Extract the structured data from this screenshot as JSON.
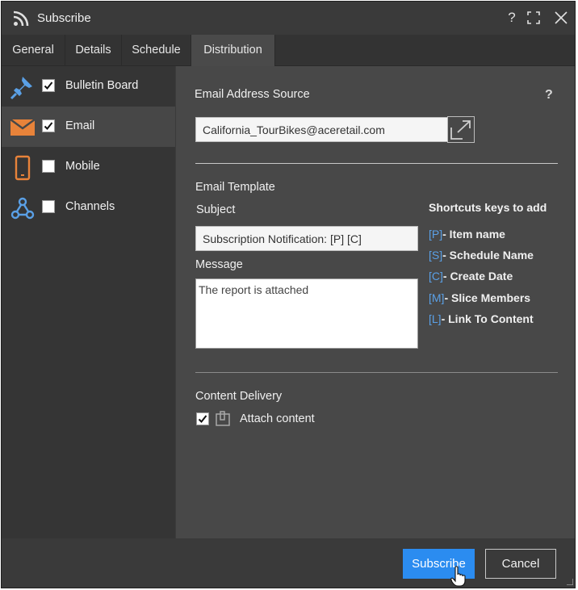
{
  "dialog": {
    "title": "Subscribe",
    "help_label": "?",
    "maximize_icon": "maximize-icon",
    "close_icon": "close-icon"
  },
  "tabs": [
    {
      "label": "General",
      "active": false
    },
    {
      "label": "Details",
      "active": false
    },
    {
      "label": "Schedule",
      "active": false
    },
    {
      "label": "Distribution",
      "active": true
    }
  ],
  "sidebar": {
    "items": [
      {
        "label": "Bulletin Board",
        "checked": true,
        "icon": "pushpin-icon",
        "selected": false
      },
      {
        "label": "Email",
        "checked": true,
        "icon": "envelope-icon",
        "selected": true
      },
      {
        "label": "Mobile",
        "checked": false,
        "icon": "mobile-icon",
        "selected": false
      },
      {
        "label": "Channels",
        "checked": false,
        "icon": "webhook-icon",
        "selected": false
      }
    ]
  },
  "email": {
    "source_label": "Email Address Source",
    "help": "?",
    "address": "California_TourBikes@aceretail.com",
    "template_label": "Email Template",
    "subject_label": "Subject",
    "subject_value": "Subscription Notification: [P] [C]",
    "message_label": "Message",
    "message_value": "The report is attached",
    "shortcuts_title": "Shortcuts keys to add",
    "shortcuts": [
      {
        "key": "[P]",
        "text": "- Item name"
      },
      {
        "key": "[S]",
        "text": "- Schedule Name"
      },
      {
        "key": "[C]",
        "text": "- Create Date"
      },
      {
        "key": "[M]",
        "text": "- Slice Members"
      },
      {
        "key": "[L]",
        "text": "- Link To Content"
      }
    ],
    "delivery_label": "Content Delivery",
    "attach_label": "Attach content",
    "attach_checked": true
  },
  "footer": {
    "subscribe_label": "Subscribe",
    "cancel_label": "Cancel"
  },
  "colors": {
    "accent": "#2b8cf0",
    "shortcut_key": "#5aa0e6",
    "icon_orange": "#e8833a",
    "icon_blue": "#5aa0e6"
  }
}
